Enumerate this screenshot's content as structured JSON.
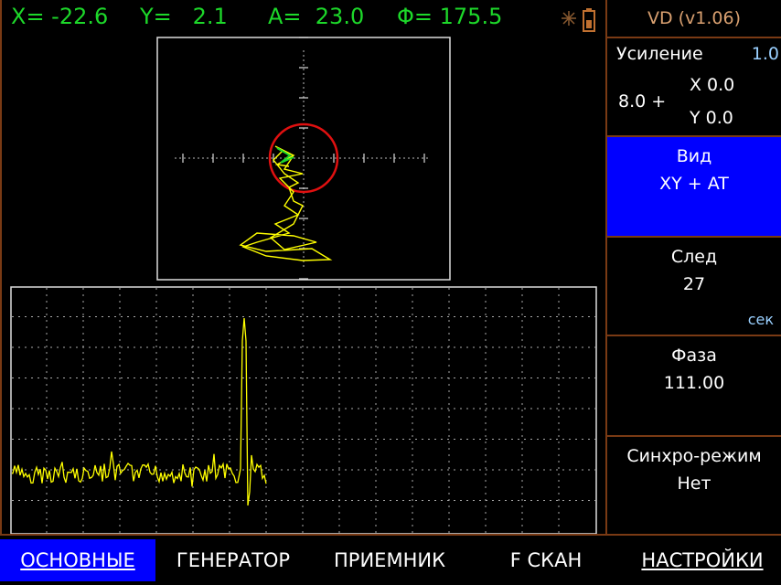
{
  "readout": {
    "x": "X= -22.6",
    "y": "Y=   2.1",
    "a": "A=  23.0",
    "phi": "Φ= 175.5"
  },
  "status_icons": [
    "brightness-icon",
    "battery-icon"
  ],
  "version": "VD (v1.06)",
  "gain": {
    "label": "Усиление",
    "step": "1.0",
    "value": "8.0 +",
    "x": "X 0.0",
    "y": "Y 0.0"
  },
  "view": {
    "label": "Вид",
    "value": "XY + AT"
  },
  "trace": {
    "label": "След",
    "value": "27",
    "unit": "сек"
  },
  "phase": {
    "label": "Фаза",
    "value": "111.00"
  },
  "sync": {
    "label": "Синхро-режим",
    "value": "Нет"
  },
  "tabs": [
    {
      "label": "ОСНОВНЫЕ",
      "active": true
    },
    {
      "label": "ГЕНЕРАТОР",
      "active": false
    },
    {
      "label": "ПРИЕМНИК",
      "active": false
    },
    {
      "label": "F СКАН",
      "active": false
    },
    {
      "label": "НАСТРОЙКИ",
      "active": false
    }
  ],
  "colors": {
    "signal": "#ffff00",
    "readout": "#1dd82a",
    "threshold_circle": "#e01010",
    "active_bg": "#0000ff",
    "frame": "#7a3a14"
  }
}
